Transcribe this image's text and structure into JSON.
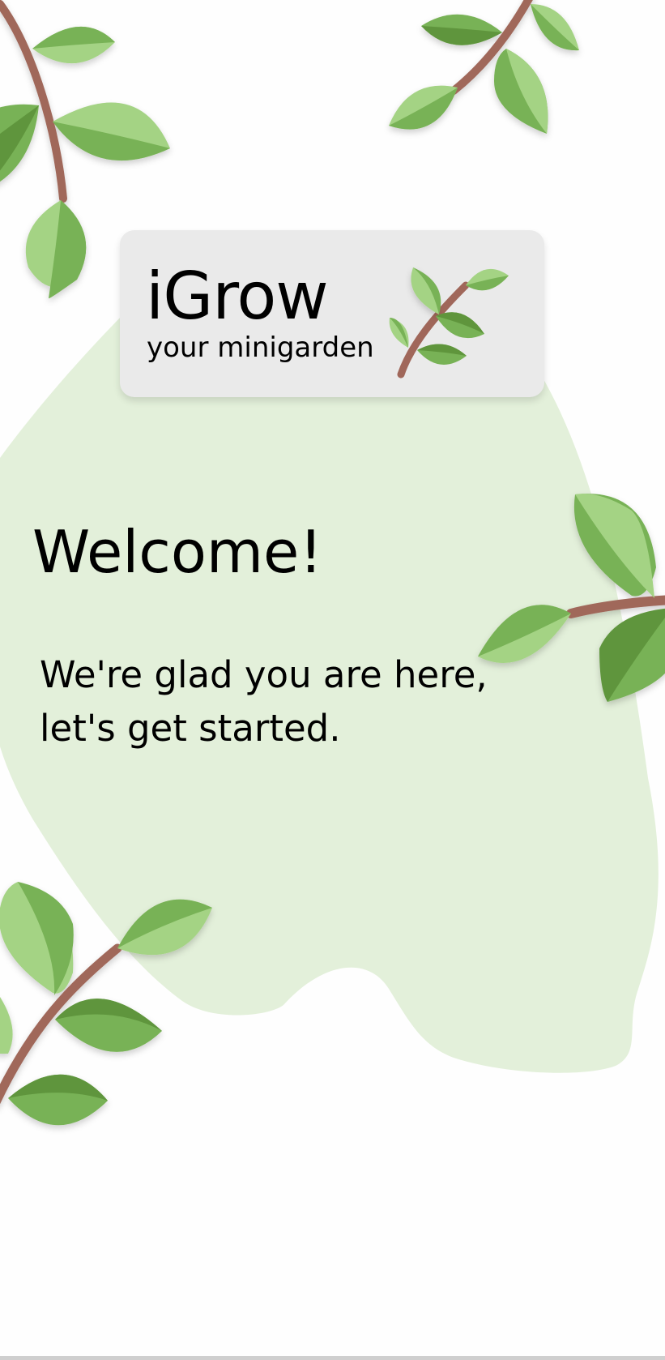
{
  "app": {
    "name": "iGrow",
    "tagline": "your minigarden"
  },
  "welcome": {
    "title": "Welcome!",
    "message_line1": "We're glad you are here,",
    "message_line2": "let's get started."
  },
  "colors": {
    "background": "#fefefe",
    "blob": "#e3f0da",
    "card": "#eaeaea",
    "branch": "#a0675a",
    "leaf_light": "#a4d384",
    "leaf_mid": "#78b256",
    "leaf_dark": "#5f953c"
  },
  "icons": {
    "logo": "leaf-sprig-icon",
    "decorations": "leafy-branch-icon"
  }
}
